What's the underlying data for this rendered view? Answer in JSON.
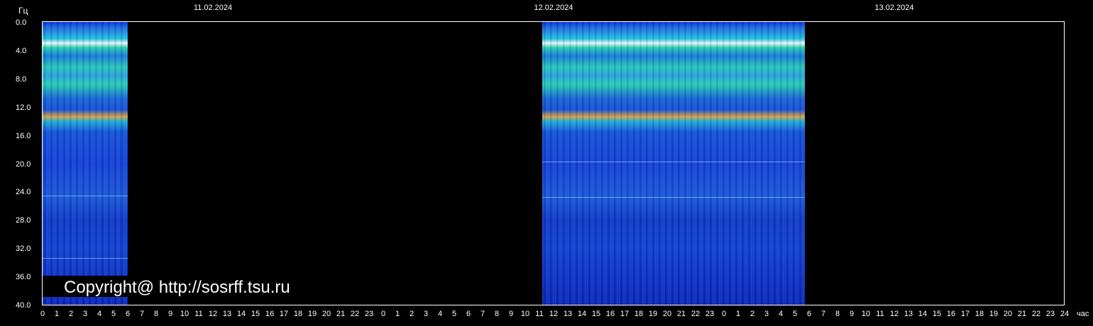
{
  "chart_data": {
    "type": "heatmap",
    "ylabel": "Гц",
    "xlabel": "час",
    "ylim": [
      0,
      40
    ],
    "yticks": [
      "0.0",
      "4.0",
      "8.0",
      "12.0",
      "16.0",
      "20.0",
      "24.0",
      "28.0",
      "32.0",
      "36.0",
      "40.0"
    ],
    "xticks": [
      "0",
      "1",
      "2",
      "3",
      "4",
      "5",
      "6",
      "7",
      "8",
      "9",
      "10",
      "11",
      "12",
      "13",
      "14",
      "15",
      "16",
      "17",
      "18",
      "19",
      "20",
      "21",
      "22",
      "23",
      "0",
      "1",
      "2",
      "3",
      "4",
      "5",
      "6",
      "7",
      "8",
      "9",
      "10",
      "11",
      "12",
      "13",
      "14",
      "15",
      "16",
      "17",
      "18",
      "19",
      "20",
      "21",
      "22",
      "23",
      "0",
      "1",
      "2",
      "3",
      "4",
      "5",
      "6",
      "7",
      "8",
      "9",
      "10",
      "11",
      "12",
      "13",
      "14",
      "15",
      "16",
      "17",
      "18",
      "19",
      "20",
      "21",
      "22",
      "23",
      "24"
    ],
    "dates": [
      {
        "label": "11.02.2024",
        "hour": 12
      },
      {
        "label": "12.02.2024",
        "hour": 36
      },
      {
        "label": "13.02.2024",
        "hour": 60
      }
    ],
    "data_segments": [
      {
        "start_hour": 0,
        "end_hour": 6
      },
      {
        "start_hour": 35.2,
        "end_hour": 53.7
      }
    ],
    "xlim": [
      0,
      72
    ]
  },
  "watermark": "Copyright@ http://sosrff.tsu.ru",
  "colors": {
    "background": "#000000",
    "axis": "#ffffff",
    "low": "#0a28b8",
    "mid": "#22c4e0",
    "high": "#f5f5f5"
  }
}
